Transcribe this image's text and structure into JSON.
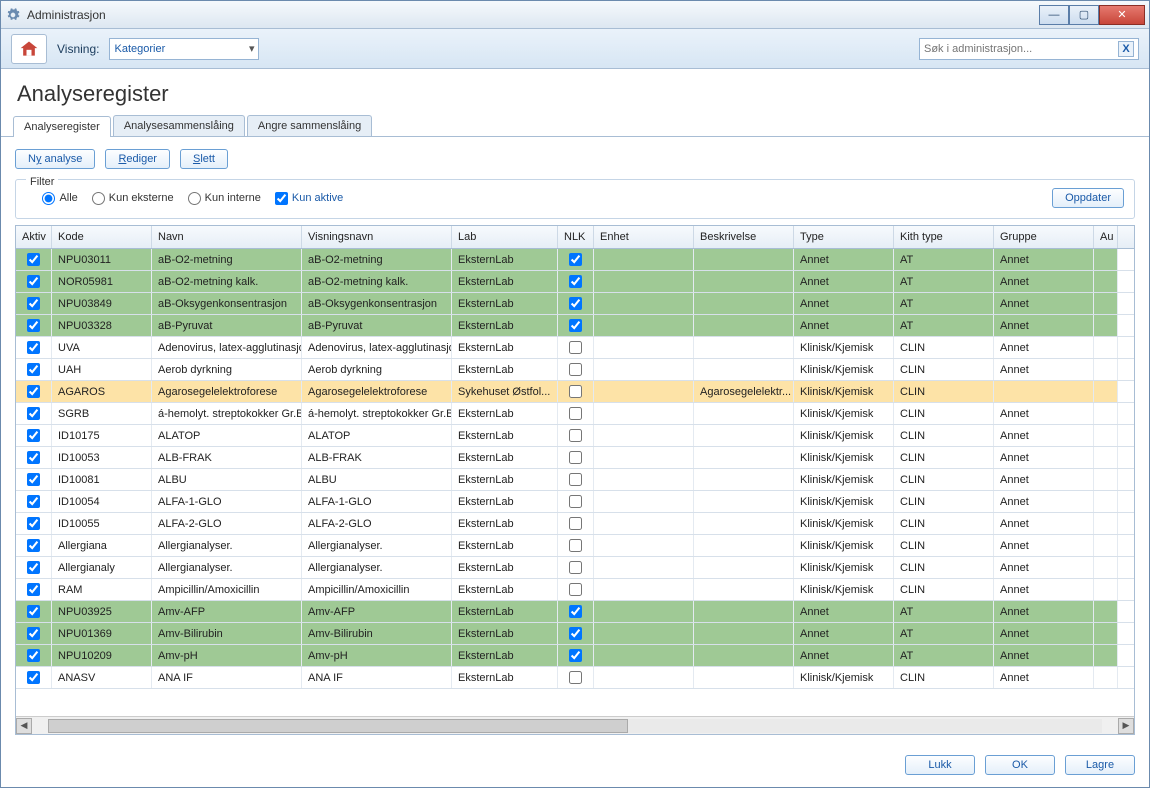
{
  "window": {
    "title": "Administrasjon"
  },
  "toolbar": {
    "visning_label": "Visning:",
    "dropdown_value": "Kategorier",
    "search_placeholder": "Søk i administrasjon..."
  },
  "page": {
    "title": "Analyseregister"
  },
  "tabs": [
    {
      "label": "Analyseregister",
      "active": true
    },
    {
      "label": "Analysesammenslåing",
      "active": false
    },
    {
      "label": "Angre sammenslåing",
      "active": false
    }
  ],
  "buttons": {
    "ny_analyse_pre": "N",
    "ny_analyse_ul": "y",
    "ny_analyse_post": " analyse",
    "rediger_ul": "R",
    "rediger_post": "ediger",
    "slett_ul": "S",
    "slett_post": "lett",
    "oppdater": "Oppdater",
    "lukk": "Lukk",
    "ok": "OK",
    "lagre": "Lagre"
  },
  "filter": {
    "legend": "Filter",
    "alle": "Alle",
    "kun_eksterne": "Kun eksterne",
    "kun_interne": "Kun interne",
    "kun_aktive": "Kun aktive"
  },
  "columns": {
    "aktiv": "Aktiv",
    "kode": "Kode",
    "navn": "Navn",
    "visningsnavn": "Visningsnavn",
    "lab": "Lab",
    "nlk": "NLK",
    "enhet": "Enhet",
    "beskrivelse": "Beskrivelse",
    "type": "Type",
    "kith": "Kith type",
    "gruppe": "Gruppe",
    "au": "Au"
  },
  "rows": [
    {
      "style": "green",
      "aktiv": true,
      "kode": "NPU03011",
      "navn": "aB-O2-metning",
      "visn": "aB-O2-metning",
      "lab": "EksternLab",
      "nlk": true,
      "enhet": "",
      "besk": "",
      "type": "Annet",
      "kith": "AT",
      "gruppe": "Annet"
    },
    {
      "style": "green",
      "aktiv": true,
      "kode": "NOR05981",
      "navn": "aB-O2-metning kalk.",
      "visn": "aB-O2-metning kalk.",
      "lab": "EksternLab",
      "nlk": true,
      "enhet": "",
      "besk": "",
      "type": "Annet",
      "kith": "AT",
      "gruppe": "Annet"
    },
    {
      "style": "green",
      "aktiv": true,
      "kode": "NPU03849",
      "navn": "aB-Oksygenkonsentrasjon",
      "visn": "aB-Oksygenkonsentrasjon",
      "lab": "EksternLab",
      "nlk": true,
      "enhet": "",
      "besk": "",
      "type": "Annet",
      "kith": "AT",
      "gruppe": "Annet"
    },
    {
      "style": "green",
      "aktiv": true,
      "kode": "NPU03328",
      "navn": "aB-Pyruvat",
      "visn": "aB-Pyruvat",
      "lab": "EksternLab",
      "nlk": true,
      "enhet": "",
      "besk": "",
      "type": "Annet",
      "kith": "AT",
      "gruppe": "Annet"
    },
    {
      "style": "",
      "aktiv": true,
      "kode": "UVA",
      "navn": "Adenovirus, latex-agglutinasjo",
      "visn": "Adenovirus, latex-agglutinasjo",
      "lab": "EksternLab",
      "nlk": false,
      "enhet": "",
      "besk": "",
      "type": "Klinisk/Kjemisk",
      "kith": "CLIN",
      "gruppe": "Annet"
    },
    {
      "style": "",
      "aktiv": true,
      "kode": "UAH",
      "navn": "Aerob dyrkning",
      "visn": "Aerob dyrkning",
      "lab": "EksternLab",
      "nlk": false,
      "enhet": "",
      "besk": "",
      "type": "Klinisk/Kjemisk",
      "kith": "CLIN",
      "gruppe": "Annet"
    },
    {
      "style": "yellow",
      "aktiv": true,
      "kode": "AGAROS",
      "navn": "Agarosegelelektroforese",
      "visn": "Agarosegelelektroforese",
      "lab": "Sykehuset Østfol...",
      "nlk": false,
      "enhet": "",
      "besk": "Agarosegelelektr...",
      "type": "Klinisk/Kjemisk",
      "kith": "CLIN",
      "gruppe": ""
    },
    {
      "style": "",
      "aktiv": true,
      "kode": "SGRB",
      "navn": "á-hemolyt. streptokokker Gr.B",
      "visn": "á-hemolyt. streptokokker Gr.B",
      "lab": "EksternLab",
      "nlk": false,
      "enhet": "",
      "besk": "",
      "type": "Klinisk/Kjemisk",
      "kith": "CLIN",
      "gruppe": "Annet"
    },
    {
      "style": "",
      "aktiv": true,
      "kode": "ID10175",
      "navn": "ALATOP",
      "visn": "ALATOP",
      "lab": "EksternLab",
      "nlk": false,
      "enhet": "",
      "besk": "",
      "type": "Klinisk/Kjemisk",
      "kith": "CLIN",
      "gruppe": "Annet"
    },
    {
      "style": "",
      "aktiv": true,
      "kode": "ID10053",
      "navn": "ALB-FRAK",
      "visn": "ALB-FRAK",
      "lab": "EksternLab",
      "nlk": false,
      "enhet": "",
      "besk": "",
      "type": "Klinisk/Kjemisk",
      "kith": "CLIN",
      "gruppe": "Annet"
    },
    {
      "style": "",
      "aktiv": true,
      "kode": "ID10081",
      "navn": "ALBU",
      "visn": "ALBU",
      "lab": "EksternLab",
      "nlk": false,
      "enhet": "",
      "besk": "",
      "type": "Klinisk/Kjemisk",
      "kith": "CLIN",
      "gruppe": "Annet"
    },
    {
      "style": "",
      "aktiv": true,
      "kode": "ID10054",
      "navn": "ALFA-1-GLO",
      "visn": "ALFA-1-GLO",
      "lab": "EksternLab",
      "nlk": false,
      "enhet": "",
      "besk": "",
      "type": "Klinisk/Kjemisk",
      "kith": "CLIN",
      "gruppe": "Annet"
    },
    {
      "style": "",
      "aktiv": true,
      "kode": "ID10055",
      "navn": "ALFA-2-GLO",
      "visn": "ALFA-2-GLO",
      "lab": "EksternLab",
      "nlk": false,
      "enhet": "",
      "besk": "",
      "type": "Klinisk/Kjemisk",
      "kith": "CLIN",
      "gruppe": "Annet"
    },
    {
      "style": "",
      "aktiv": true,
      "kode": "Allergiana",
      "navn": "Allergianalyser.",
      "visn": "Allergianalyser.",
      "lab": "EksternLab",
      "nlk": false,
      "enhet": "",
      "besk": "",
      "type": "Klinisk/Kjemisk",
      "kith": "CLIN",
      "gruppe": "Annet"
    },
    {
      "style": "",
      "aktiv": true,
      "kode": "Allergianaly",
      "navn": "Allergianalyser.",
      "visn": "Allergianalyser.",
      "lab": "EksternLab",
      "nlk": false,
      "enhet": "",
      "besk": "",
      "type": "Klinisk/Kjemisk",
      "kith": "CLIN",
      "gruppe": "Annet"
    },
    {
      "style": "",
      "aktiv": true,
      "kode": "RAM",
      "navn": "Ampicillin/Amoxicillin",
      "visn": "Ampicillin/Amoxicillin",
      "lab": "EksternLab",
      "nlk": false,
      "enhet": "",
      "besk": "",
      "type": "Klinisk/Kjemisk",
      "kith": "CLIN",
      "gruppe": "Annet"
    },
    {
      "style": "green",
      "aktiv": true,
      "kode": "NPU03925",
      "navn": "Amv-AFP",
      "visn": "Amv-AFP",
      "lab": "EksternLab",
      "nlk": true,
      "enhet": "",
      "besk": "",
      "type": "Annet",
      "kith": "AT",
      "gruppe": "Annet"
    },
    {
      "style": "green",
      "aktiv": true,
      "kode": "NPU01369",
      "navn": "Amv-Bilirubin",
      "visn": "Amv-Bilirubin",
      "lab": "EksternLab",
      "nlk": true,
      "enhet": "",
      "besk": "",
      "type": "Annet",
      "kith": "AT",
      "gruppe": "Annet"
    },
    {
      "style": "green",
      "aktiv": true,
      "kode": "NPU10209",
      "navn": "Amv-pH",
      "visn": "Amv-pH",
      "lab": "EksternLab",
      "nlk": true,
      "enhet": "",
      "besk": "",
      "type": "Annet",
      "kith": "AT",
      "gruppe": "Annet"
    },
    {
      "style": "",
      "aktiv": true,
      "kode": "ANASV",
      "navn": "ANA IF",
      "visn": "ANA IF",
      "lab": "EksternLab",
      "nlk": false,
      "enhet": "",
      "besk": "",
      "type": "Klinisk/Kjemisk",
      "kith": "CLIN",
      "gruppe": "Annet"
    }
  ]
}
